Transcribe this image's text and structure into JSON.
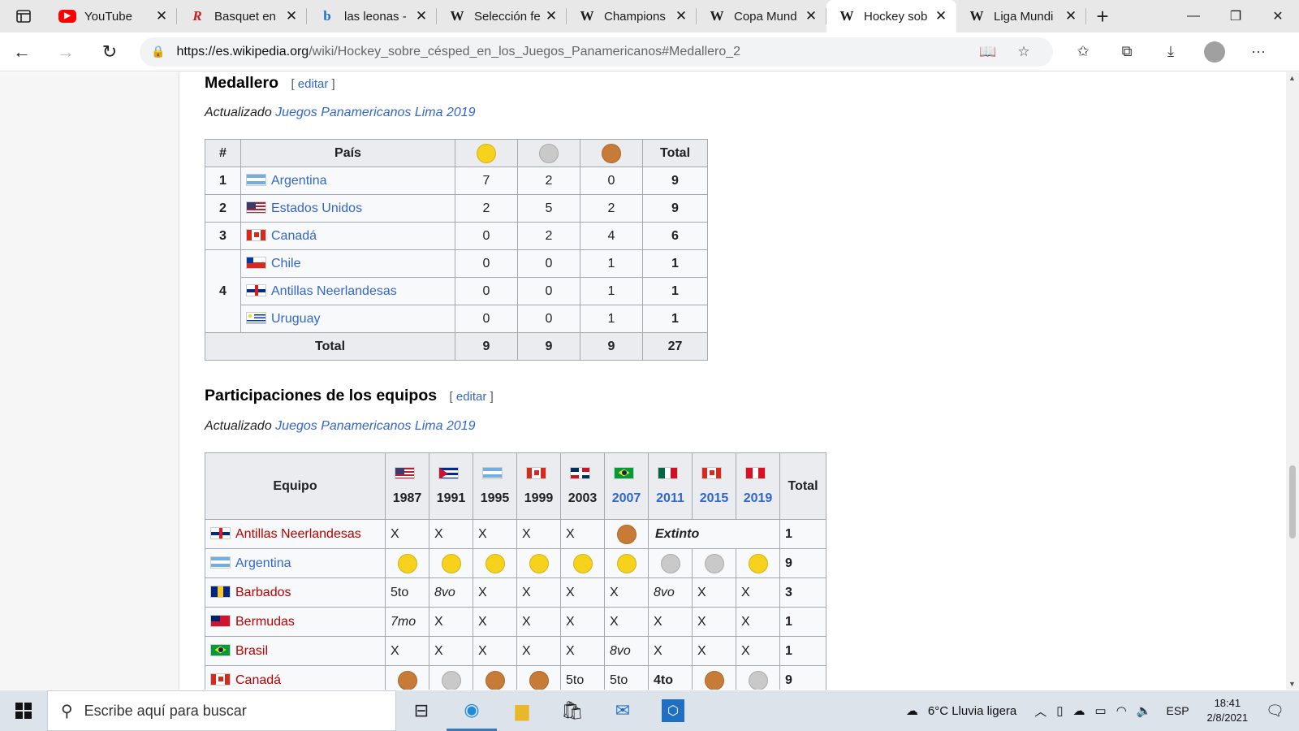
{
  "browser": {
    "tabs": [
      {
        "title": "YouTube",
        "favicon": "youtube-icon",
        "fav_glyph": "▶",
        "active": false
      },
      {
        "title": "Basquet en",
        "favicon": "basquet-icon",
        "fav_glyph": "R",
        "active": false
      },
      {
        "title": "las leonas -",
        "favicon": "bing-icon",
        "fav_glyph": "b",
        "active": false
      },
      {
        "title": "Selección fe",
        "favicon": "wikipedia-icon",
        "fav_glyph": "W",
        "active": false
      },
      {
        "title": "Champions",
        "favicon": "wikipedia-icon",
        "fav_glyph": "W",
        "active": false
      },
      {
        "title": "Copa Mund",
        "favicon": "wikipedia-icon",
        "fav_glyph": "W",
        "active": false
      },
      {
        "title": "Hockey sob",
        "favicon": "wikipedia-icon",
        "fav_glyph": "W",
        "active": true
      },
      {
        "title": "Liga Mundi",
        "favicon": "wikipedia-icon",
        "fav_glyph": "W",
        "active": false
      }
    ],
    "url_host": "https://es.wikipedia.org",
    "url_rest": "/wiki/Hockey_sobre_césped_en_los_Juegos_Panamericanos#Medallero_2"
  },
  "medallero": {
    "heading": "Medallero",
    "edit_open": "[",
    "edit_label": "editar",
    "edit_close": "]",
    "updated_prefix": "Actualizado",
    "updated_link": "Juegos Panamericanos Lima 2019",
    "headers": {
      "rank": "#",
      "country": "País",
      "total": "Total"
    },
    "rows": [
      {
        "rank": "1",
        "country": "Argentina",
        "flag": "argentina",
        "gold": "7",
        "silver": "2",
        "bronze": "0",
        "total": "9"
      },
      {
        "rank": "2",
        "country": "Estados Unidos",
        "flag": "usa",
        "gold": "2",
        "silver": "5",
        "bronze": "2",
        "total": "9"
      },
      {
        "rank": "3",
        "country": "Canadá",
        "flag": "canada",
        "gold": "0",
        "silver": "2",
        "bronze": "4",
        "total": "6"
      },
      {
        "rank": "4",
        "country": "Chile",
        "flag": "chile",
        "gold": "0",
        "silver": "0",
        "bronze": "1",
        "total": "1"
      },
      {
        "rank": "",
        "country": "Antillas Neerlandesas",
        "flag": "antillas",
        "gold": "0",
        "silver": "0",
        "bronze": "1",
        "total": "1"
      },
      {
        "rank": "",
        "country": "Uruguay",
        "flag": "uruguay",
        "gold": "0",
        "silver": "0",
        "bronze": "1",
        "total": "1"
      }
    ],
    "totals": {
      "label": "Total",
      "gold": "9",
      "silver": "9",
      "bronze": "9",
      "total": "27"
    }
  },
  "participaciones": {
    "heading": "Participaciones de los equipos",
    "edit_open": "[",
    "edit_label": "editar",
    "edit_close": "]",
    "updated_prefix": "Actualizado",
    "updated_link": "Juegos Panamericanos Lima 2019",
    "team_header": "Equipo",
    "total_header": "Total",
    "years": [
      {
        "year": "1987",
        "flag": "usa",
        "linked": false
      },
      {
        "year": "1991",
        "flag": "cuba",
        "linked": false
      },
      {
        "year": "1995",
        "flag": "argentina",
        "linked": false
      },
      {
        "year": "1999",
        "flag": "canada",
        "linked": false
      },
      {
        "year": "2003",
        "flag": "dominicana",
        "linked": false
      },
      {
        "year": "2007",
        "flag": "brasil",
        "linked": true
      },
      {
        "year": "2011",
        "flag": "mexico",
        "linked": true
      },
      {
        "year": "2015",
        "flag": "canada",
        "linked": true
      },
      {
        "year": "2019",
        "flag": "peru",
        "linked": true
      }
    ],
    "rows": [
      {
        "team": "Antillas Neerlandesas",
        "flag": "antillas",
        "link": "red",
        "cells": [
          "X",
          "X",
          "X",
          "X",
          "X",
          "bronze"
        ],
        "merged": "Extinto",
        "total": "1"
      },
      {
        "team": "Argentina",
        "flag": "argentina",
        "link": "blue",
        "cells": [
          "gold",
          "gold",
          "gold",
          "gold",
          "gold",
          "gold",
          "silver",
          "silver",
          "gold"
        ],
        "total": "9"
      },
      {
        "team": "Barbados",
        "flag": "barbados",
        "link": "red",
        "cells": [
          "5to",
          "8vo",
          "X",
          "X",
          "X",
          "X",
          "8vo",
          "X",
          "X"
        ],
        "total": "3"
      },
      {
        "team": "Bermudas",
        "flag": "bermudas",
        "link": "red",
        "cells": [
          "7mo",
          "X",
          "X",
          "X",
          "X",
          "X",
          "X",
          "X",
          "X"
        ],
        "total": "1"
      },
      {
        "team": "Brasil",
        "flag": "brasil",
        "link": "red",
        "cells": [
          "X",
          "X",
          "X",
          "X",
          "X",
          "8vo",
          "X",
          "X",
          "X"
        ],
        "total": "1"
      },
      {
        "team": "Canadá",
        "flag": "canada",
        "link": "red",
        "cells": [
          "bronze",
          "silver",
          "bronze",
          "bronze",
          "5to",
          "5to",
          "4to",
          "bronze",
          "silver"
        ],
        "total": "9"
      }
    ]
  },
  "taskbar": {
    "search_placeholder": "Escribe aquí para buscar",
    "weather": "6°C  Lluvia ligera",
    "lang": "ESP",
    "time": "18:41",
    "date": "2/8/2021"
  },
  "colors": {
    "link": "#3366cc",
    "redlink": "#ba0000",
    "gold": "#f7d21c",
    "silver": "#c9c9c9",
    "bronze": "#c77b36"
  }
}
